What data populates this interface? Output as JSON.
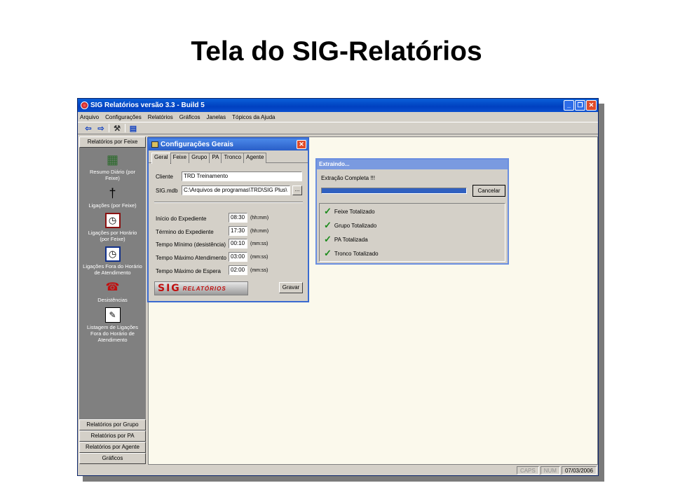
{
  "slide_title": "Tela do SIG-Relatórios",
  "window": {
    "title": "SIG Relatórios versão 3.3 - Build 5",
    "title_color": "#0a4fd0"
  },
  "menu": [
    "Arquivo",
    "Configurações",
    "Relatórios",
    "Gráficos",
    "Janelas",
    "Tópicos da Ajuda"
  ],
  "sidebar": {
    "top_button": "Relatórios por Feixe",
    "items": [
      {
        "icon": "calendar-icon",
        "label": "Resumo Diário (por Feixe)"
      },
      {
        "icon": "antenna-icon",
        "label": "Ligações (por Feixe)"
      },
      {
        "icon": "clock-icon",
        "label": "Ligações por Horário (por Feixe)"
      },
      {
        "icon": "clock-icon",
        "label": "Ligações Fora do Horário de Atendimento"
      },
      {
        "icon": "phone-icon",
        "label": "Desistências"
      },
      {
        "icon": "monitor-icon",
        "label": "Listagem de Ligações Fora do Horário de Atendimento"
      }
    ],
    "bottom_buttons": [
      "Relatórios por Grupo",
      "Relatórios por PA",
      "Relatórios por Agente",
      "Gráficos"
    ]
  },
  "config_dialog": {
    "title": "Configurações Gerais",
    "tabs": [
      "Geral",
      "Feixe",
      "Grupo",
      "PA",
      "Tronco",
      "Agente"
    ],
    "cliente_label": "Cliente",
    "cliente_value": "TRD Treinamento",
    "sigmdb_label": "SIG.mdb",
    "sigmdb_value": "C:\\Arquivos de programas\\TRD\\SIG Plus\\",
    "browse_label": "...",
    "fields": [
      {
        "label": "Início do Expediente",
        "value": "08:30",
        "unit": "(hh:mm)"
      },
      {
        "label": "Término do Expediente",
        "value": "17:30",
        "unit": "(hh:mm)"
      },
      {
        "label": "Tempo Mínimo (desistência)",
        "value": "00:10",
        "unit": "(mm:ss)"
      },
      {
        "label": "Tempo Máximo Atendimento",
        "value": "03:00",
        "unit": "(mm:ss)"
      },
      {
        "label": "Tempo Máximo de Espera",
        "value": "02:00",
        "unit": "(mm:ss)"
      }
    ],
    "logo_big": "SIG",
    "logo_small": "RELATÓRIOS",
    "save_label": "Gravar"
  },
  "extract_dialog": {
    "title": "Extraindo...",
    "status": "Extração Completa !!!",
    "progress": 1.0,
    "cancel_label": "Cancelar",
    "done_items": [
      "Feixe Totalizado",
      "Grupo Totalizado",
      "PA Totalizada",
      "Tronco Totalizado"
    ]
  },
  "statusbar": {
    "caps": "CAPS",
    "num": "NUM",
    "date": "07/03/2006"
  }
}
